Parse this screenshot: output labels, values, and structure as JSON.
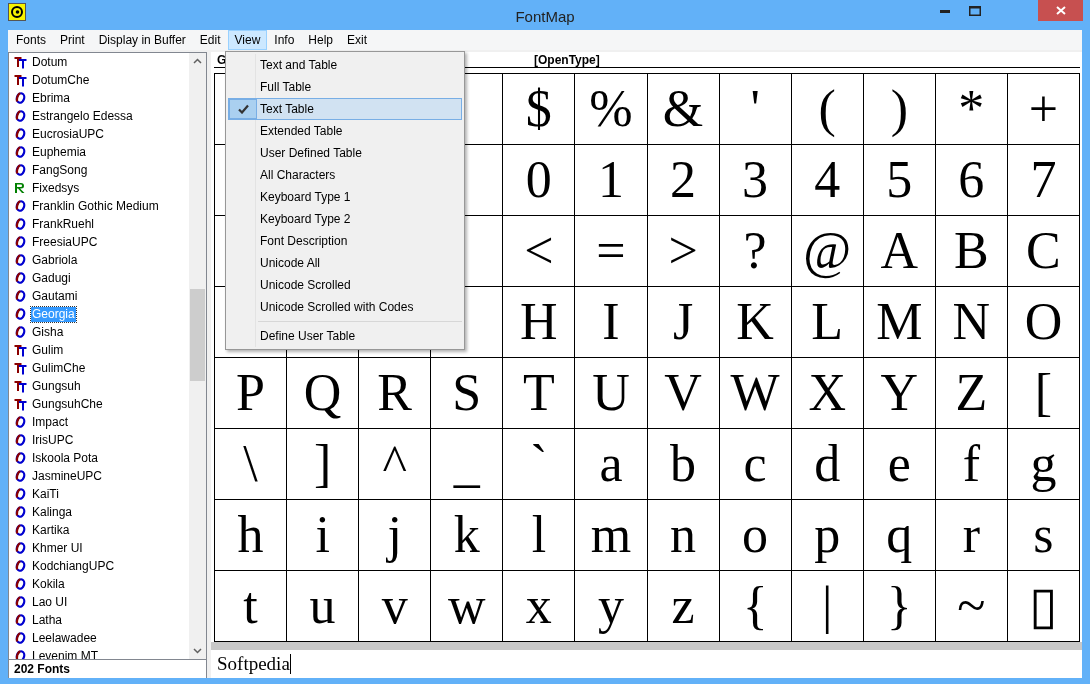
{
  "window": {
    "title": "FontMap"
  },
  "menu_bar": [
    {
      "label": "Fonts",
      "selected": false
    },
    {
      "label": "Print",
      "selected": false
    },
    {
      "label": "Display in Buffer",
      "selected": false
    },
    {
      "label": "Edit",
      "selected": false
    },
    {
      "label": "View",
      "selected": true
    },
    {
      "label": "Info",
      "selected": false
    },
    {
      "label": "Help",
      "selected": false
    },
    {
      "label": "Exit",
      "selected": false
    }
  ],
  "view_menu": [
    {
      "kind": "item",
      "label": "Text and Table",
      "checked": false,
      "selected": false
    },
    {
      "kind": "item",
      "label": "Full Table",
      "checked": false,
      "selected": false
    },
    {
      "kind": "item",
      "label": "Text Table",
      "checked": true,
      "selected": true
    },
    {
      "kind": "item",
      "label": "Extended Table",
      "checked": false,
      "selected": false
    },
    {
      "kind": "item",
      "label": "User Defined Table",
      "checked": false,
      "selected": false
    },
    {
      "kind": "item",
      "label": "All Characters",
      "checked": false,
      "selected": false
    },
    {
      "kind": "item",
      "label": "Keyboard Type 1",
      "checked": false,
      "selected": false
    },
    {
      "kind": "item",
      "label": "Keyboard Type 2",
      "checked": false,
      "selected": false
    },
    {
      "kind": "item",
      "label": "Font Description",
      "checked": false,
      "selected": false
    },
    {
      "kind": "item",
      "label": "Unicode All",
      "checked": false,
      "selected": false
    },
    {
      "kind": "item",
      "label": "Unicode Scrolled",
      "checked": false,
      "selected": false
    },
    {
      "kind": "item",
      "label": "Unicode Scrolled with Codes",
      "checked": false,
      "selected": false
    },
    {
      "kind": "separator"
    },
    {
      "kind": "item",
      "label": "Define User Table",
      "checked": false,
      "selected": false
    }
  ],
  "font_list": [
    {
      "name": "Dotum",
      "kind": "truetype",
      "selected": false
    },
    {
      "name": "DotumChe",
      "kind": "truetype",
      "selected": false
    },
    {
      "name": "Ebrima",
      "kind": "opentype",
      "selected": false
    },
    {
      "name": "Estrangelo Edessa",
      "kind": "opentype",
      "selected": false
    },
    {
      "name": "EucrosiaUPC",
      "kind": "opentype",
      "selected": false
    },
    {
      "name": "Euphemia",
      "kind": "opentype",
      "selected": false
    },
    {
      "name": "FangSong",
      "kind": "opentype",
      "selected": false
    },
    {
      "name": "Fixedsys",
      "kind": "raster",
      "selected": false
    },
    {
      "name": "Franklin Gothic Medium",
      "kind": "opentype",
      "selected": false
    },
    {
      "name": "FrankRuehl",
      "kind": "opentype",
      "selected": false
    },
    {
      "name": "FreesiaUPC",
      "kind": "opentype",
      "selected": false
    },
    {
      "name": "Gabriola",
      "kind": "opentype",
      "selected": false
    },
    {
      "name": "Gadugi",
      "kind": "opentype",
      "selected": false
    },
    {
      "name": "Gautami",
      "kind": "opentype",
      "selected": false
    },
    {
      "name": "Georgia",
      "kind": "opentype",
      "selected": true
    },
    {
      "name": "Gisha",
      "kind": "opentype",
      "selected": false
    },
    {
      "name": "Gulim",
      "kind": "truetype",
      "selected": false
    },
    {
      "name": "GulimChe",
      "kind": "truetype",
      "selected": false
    },
    {
      "name": "Gungsuh",
      "kind": "truetype",
      "selected": false
    },
    {
      "name": "GungsuhChe",
      "kind": "truetype",
      "selected": false
    },
    {
      "name": "Impact",
      "kind": "opentype",
      "selected": false
    },
    {
      "name": "IrisUPC",
      "kind": "opentype",
      "selected": false
    },
    {
      "name": "Iskoola Pota",
      "kind": "opentype",
      "selected": false
    },
    {
      "name": "JasmineUPC",
      "kind": "opentype",
      "selected": false
    },
    {
      "name": "KaiTi",
      "kind": "opentype",
      "selected": false
    },
    {
      "name": "Kalinga",
      "kind": "opentype",
      "selected": false
    },
    {
      "name": "Kartika",
      "kind": "opentype",
      "selected": false
    },
    {
      "name": "Khmer UI",
      "kind": "opentype",
      "selected": false
    },
    {
      "name": "KodchiangUPC",
      "kind": "opentype",
      "selected": false
    },
    {
      "name": "Kokila",
      "kind": "opentype",
      "selected": false
    },
    {
      "name": "Lao UI",
      "kind": "opentype",
      "selected": false
    },
    {
      "name": "Latha",
      "kind": "opentype",
      "selected": false
    },
    {
      "name": "Leelawadee",
      "kind": "opentype",
      "selected": false
    },
    {
      "name": "Levenim MT",
      "kind": "opentype",
      "selected": false
    }
  ],
  "font_count": "202 Fonts",
  "table_header": {
    "font_name": "G",
    "font_type": "[OpenType]"
  },
  "char_table": [
    [
      "$",
      "%",
      "&",
      "'",
      "(",
      ")",
      "*",
      "+"
    ],
    [
      "0",
      "1",
      "2",
      "3",
      "4",
      "5",
      "6",
      "7"
    ],
    [
      "<",
      "=",
      ">",
      "?",
      "@",
      "A",
      "B",
      "C"
    ],
    [
      "H",
      "I",
      "J",
      "K",
      "L",
      "M",
      "N",
      "O"
    ],
    [
      "P",
      "Q",
      "R",
      "S",
      "T",
      "U",
      "V",
      "W",
      "X",
      "Y",
      "Z",
      "["
    ],
    [
      "\\",
      "]",
      "^",
      "_",
      "`",
      "a",
      "b",
      "c",
      "d",
      "e",
      "f",
      "g"
    ],
    [
      "h",
      "i",
      "j",
      "k",
      "l",
      "m",
      "n",
      "o",
      "p",
      "q",
      "r",
      "s"
    ],
    [
      "t",
      "u",
      "v",
      "w",
      "x",
      "y",
      "z",
      "{",
      "|",
      "}",
      "~",
      "▯"
    ]
  ],
  "buffer_text": "Softpedia"
}
